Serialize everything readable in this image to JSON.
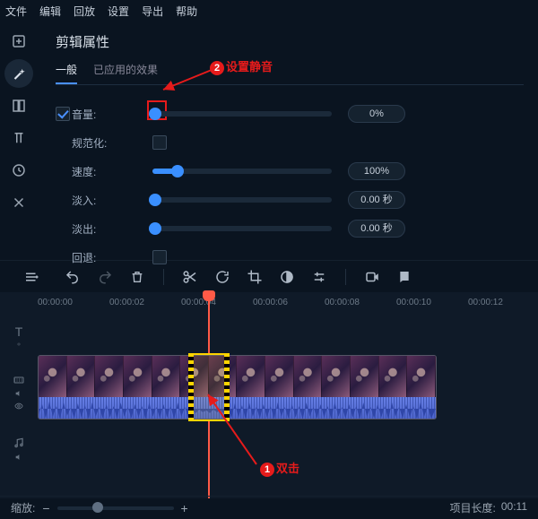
{
  "menu": {
    "file": "文件",
    "edit": "编辑",
    "playback": "回放",
    "settings": "设置",
    "export": "导出",
    "help": "帮助"
  },
  "panel": {
    "title": "剪辑属性",
    "tabs": {
      "general": "一般",
      "applied": "已应用的效果"
    },
    "rows": {
      "volume": {
        "label": "音量:",
        "value": "0%"
      },
      "normalize": {
        "label": "规范化:"
      },
      "speed": {
        "label": "速度:",
        "value": "100%"
      },
      "fadein": {
        "label": "淡入:",
        "value": "0.00 秒"
      },
      "fadeout": {
        "label": "淡出:",
        "value": "0.00 秒"
      },
      "reverse": {
        "label": "回退:"
      }
    }
  },
  "annotations": {
    "mute": "设置静音",
    "dblclick": "双击"
  },
  "ruler": [
    "00:00:00",
    "00:00:02",
    "00:00:04",
    "00:00:06",
    "00:00:08",
    "00:00:10",
    "00:00:12"
  ],
  "status": {
    "zoom_label": "缩放:",
    "proj_label": "项目长度:",
    "proj_len": "00:11"
  }
}
